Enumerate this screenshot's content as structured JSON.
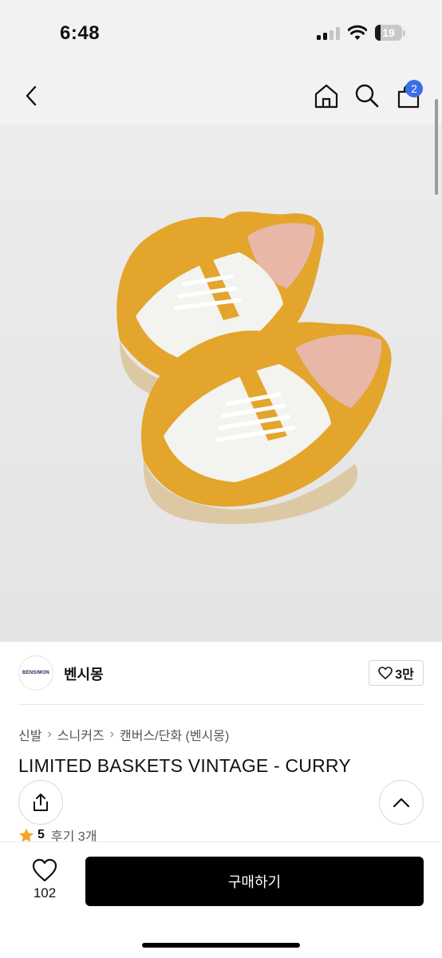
{
  "status_bar": {
    "time": "6:48",
    "battery": "19"
  },
  "nav": {
    "cart_count": "2"
  },
  "brand": {
    "logo_text": "BENSIMON",
    "name": "벤시몽",
    "like_count": "3만"
  },
  "breadcrumb": [
    "신발",
    "스니커즈",
    "캔버스/단화 (벤시몽)"
  ],
  "product": {
    "title": "LIMITED BASKETS VINTAGE - CURRY",
    "rating": "5",
    "review_link": "후기 3개"
  },
  "bottom_bar": {
    "like_count": "102",
    "buy_label": "구매하기"
  },
  "colors": {
    "accent_badge": "#3b6de6",
    "star": "#f5a623",
    "buy_button": "#000000",
    "shoe_suede": "#e3a52c"
  },
  "icons": [
    "back-chevron-icon",
    "home-icon",
    "search-icon",
    "cart-icon",
    "heart-icon",
    "share-icon",
    "chevron-up-icon",
    "star-icon"
  ]
}
